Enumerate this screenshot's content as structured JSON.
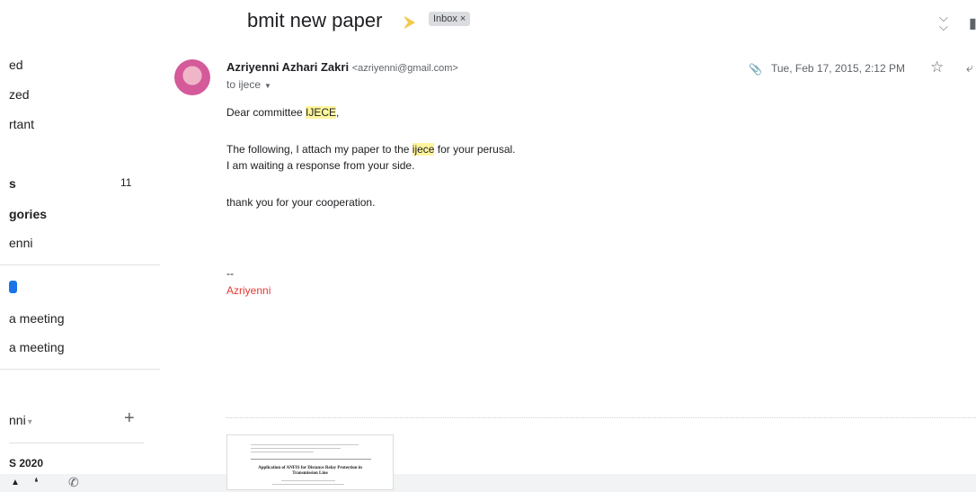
{
  "sidebar": {
    "items": [
      {
        "label": "ed"
      },
      {
        "label": "zed"
      },
      {
        "label": "rtant"
      },
      {
        "label": "s",
        "count": "11"
      },
      {
        "label": "gories"
      },
      {
        "label": "enni"
      },
      {
        "label": "a meeting"
      },
      {
        "label": "a meeting"
      },
      {
        "label": "nni"
      },
      {
        "label": "S 2020"
      }
    ]
  },
  "thread": {
    "subject": "bmit new paper",
    "label": "Inbox",
    "label_close": "×"
  },
  "message": {
    "sender_name": "Azriyenni Azhari Zakri",
    "sender_email": "<azriyenni@gmail.com>",
    "recipient": "to ijece",
    "date": "Tue, Feb 17, 2015, 2:12 PM",
    "body": {
      "greeting_prefix": "Dear committee ",
      "greeting_highlight": "IJECE",
      "greeting_suffix": ",",
      "line1_prefix": "The following, I attach my paper to the ",
      "line1_highlight": "ijece",
      "line1_suffix": " for your perusal.",
      "line2": "I am waiting a response from your side.",
      "line3": "thank you for your cooperation."
    },
    "signature_dash": "--",
    "signature_name": "Azriyenni"
  },
  "attachment": {
    "preview_title": "Application of ANFIS for Distance Relay Protection in Transmission Line"
  },
  "colors": {
    "highlight": "#fff59d",
    "signature": "#e53935",
    "importance": "#f2c94c",
    "label_bg": "#dadce0"
  }
}
